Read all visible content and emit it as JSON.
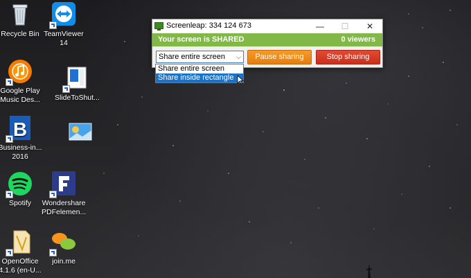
{
  "desktop": {
    "icons": [
      {
        "label": "Recycle Bin",
        "icon": "recycle-bin-icon"
      },
      {
        "label": "TeamViewer 14",
        "icon": "teamviewer-icon"
      },
      {
        "label": "Google Play Music Des...",
        "icon": "google-play-music-icon"
      },
      {
        "label": "SlideToShut...",
        "icon": "slide-to-shutdown-icon"
      },
      {
        "label": "Business-in... 2016",
        "icon": "business-in-icon"
      },
      {
        "label": "",
        "icon": "image-file-icon"
      },
      {
        "label": "Spotify",
        "icon": "spotify-icon"
      },
      {
        "label": "Wondershare PDFelemen...",
        "icon": "pdfelement-icon"
      },
      {
        "label": "OpenOffice 4.1.6 (en-U...",
        "icon": "openoffice-icon"
      },
      {
        "label": "join.me",
        "icon": "joinme-icon"
      }
    ]
  },
  "window": {
    "title": "Screenleap: 334 124 673",
    "minimize": "—",
    "maximize": "☐",
    "close": "✕",
    "status_text": "Your screen is SHARED",
    "viewers_text": "0 viewers",
    "status_color": "#82b848",
    "share_select": {
      "value": "Share entire screen",
      "options": [
        "Share entire screen",
        "Share inside rectangle"
      ],
      "highlighted": "Share inside rectangle"
    },
    "pause_label": "Pause sharing",
    "stop_label": "Stop sharing",
    "pause_color": "#e57f0f",
    "stop_color": "#c9301c"
  }
}
